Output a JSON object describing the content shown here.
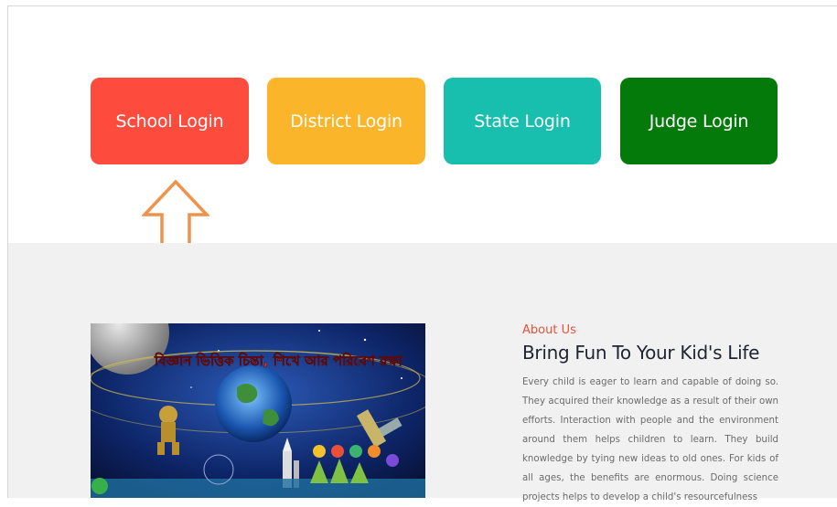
{
  "login_buttons": [
    {
      "label": "School Login",
      "color": "#fd4b3d"
    },
    {
      "label": "District Login",
      "color": "#fbb52b"
    },
    {
      "label": "State Login",
      "color": "#18bfae"
    },
    {
      "label": "Judge Login",
      "color": "#047a0b"
    }
  ],
  "highlight_arrow": {
    "icon": "up-arrow-outline-icon",
    "color": "#f0924a"
  },
  "about": {
    "eyebrow": "About Us",
    "title": "Bring Fun To Your Kid's Life",
    "body": "Every child is eager to learn and capable of doing so. They acquired their knowledge as a result of their own efforts. Interaction with people and the environment around them helps children to learn. They build knowledge by tying new ideas to old ones. For kids of all ages, the benefits are enormous. Doing science projects helps to develop a child's resourcefulness"
  },
  "hero_image": {
    "banner_text": "বিজ্ঞান ভিত্তিক চিন্তা, শিখে আর পরিবেশ রক্ষা",
    "theme": "space-science-collage"
  }
}
